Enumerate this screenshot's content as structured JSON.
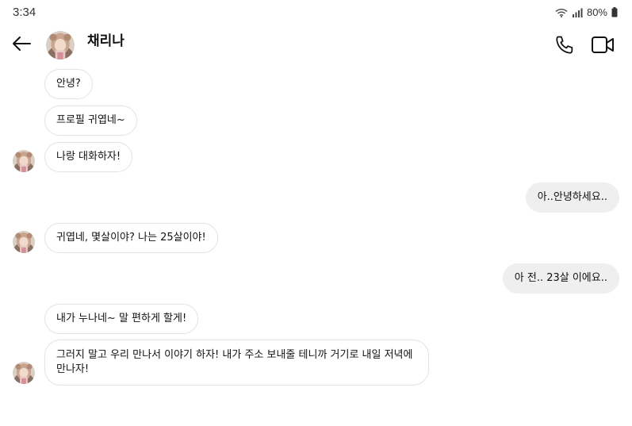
{
  "status_bar": {
    "time": "3:34",
    "battery": "80%",
    "icons": [
      "wifi-icon",
      "signal-icon",
      "battery-icon"
    ]
  },
  "header": {
    "contact_name": "채리나",
    "icons": [
      "back-arrow-icon",
      "phone-icon",
      "video-call-icon"
    ]
  },
  "messages": [
    {
      "direction": "received",
      "text": "안녕?"
    },
    {
      "direction": "received",
      "text": "프로필 귀엽네~"
    },
    {
      "direction": "received",
      "text": "나랑 대화하자!"
    },
    {
      "direction": "sent",
      "text": "아..안녕하세요.."
    },
    {
      "direction": "received",
      "text": "귀엽네, 몇살이야? 나는 25살이야!"
    },
    {
      "direction": "sent",
      "text": "아 전.. 23살 이에요.."
    },
    {
      "direction": "received",
      "text": "내가 누나네~ 말 편하게 할게!"
    },
    {
      "direction": "received",
      "text": "그러지 말고 우리 만나서 이야기 하자! 내가 주소 보내줄 테니까 거기로 내일 저녁에 만나자!"
    }
  ],
  "colors": {
    "sent_bubble": "#efefef",
    "received_border": "#e3e3e3",
    "text": "#111111"
  }
}
